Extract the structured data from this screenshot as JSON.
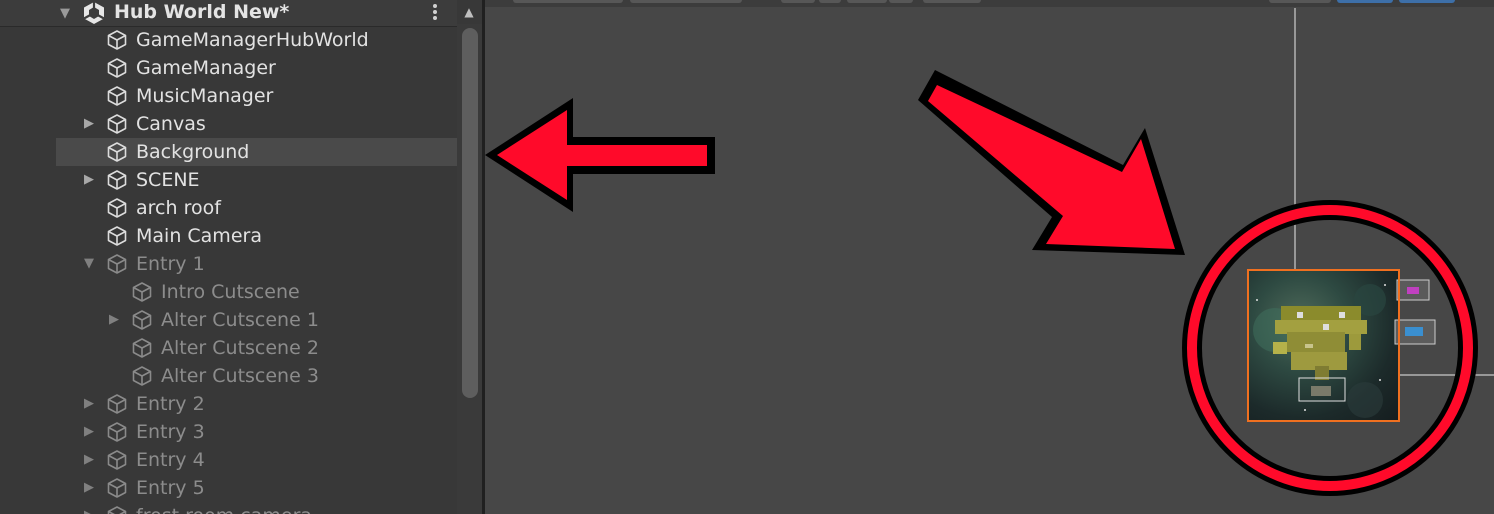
{
  "hierarchy": {
    "scene_title": "Hub World New*",
    "items": [
      {
        "label": "GameManagerHubWorld",
        "depth": 0,
        "expand": "none",
        "dim": false,
        "selected": false
      },
      {
        "label": "GameManager",
        "depth": 0,
        "expand": "none",
        "dim": false,
        "selected": false
      },
      {
        "label": "MusicManager",
        "depth": 0,
        "expand": "none",
        "dim": false,
        "selected": false
      },
      {
        "label": "Canvas",
        "depth": 0,
        "expand": "collapsed",
        "dim": false,
        "selected": false
      },
      {
        "label": "Background",
        "depth": 0,
        "expand": "none",
        "dim": false,
        "selected": true
      },
      {
        "label": "SCENE",
        "depth": 0,
        "expand": "collapsed",
        "dim": false,
        "selected": false
      },
      {
        "label": "arch roof",
        "depth": 0,
        "expand": "none",
        "dim": false,
        "selected": false
      },
      {
        "label": "Main Camera",
        "depth": 0,
        "expand": "none",
        "dim": false,
        "selected": false
      },
      {
        "label": "Entry 1",
        "depth": 0,
        "expand": "expanded",
        "dim": true,
        "selected": false
      },
      {
        "label": "Intro Cutscene",
        "depth": 1,
        "expand": "none",
        "dim": true,
        "selected": false
      },
      {
        "label": "Alter Cutscene 1",
        "depth": 1,
        "expand": "collapsed",
        "dim": true,
        "selected": false
      },
      {
        "label": "Alter Cutscene 2",
        "depth": 1,
        "expand": "none",
        "dim": true,
        "selected": false
      },
      {
        "label": "Alter Cutscene 3",
        "depth": 1,
        "expand": "none",
        "dim": true,
        "selected": false
      },
      {
        "label": "Entry 2",
        "depth": 0,
        "expand": "collapsed",
        "dim": true,
        "selected": false
      },
      {
        "label": "Entry 3",
        "depth": 0,
        "expand": "collapsed",
        "dim": true,
        "selected": false
      },
      {
        "label": "Entry 4",
        "depth": 0,
        "expand": "collapsed",
        "dim": true,
        "selected": false
      },
      {
        "label": "Entry 5",
        "depth": 0,
        "expand": "collapsed",
        "dim": true,
        "selected": false
      },
      {
        "label": "frost room camera",
        "depth": 0,
        "expand": "collapsed",
        "dim": true,
        "selected": false
      }
    ]
  },
  "scene": {
    "selection_color": "#f07020",
    "annotation_color": "#ff0a2a"
  },
  "icons": {
    "scene": "unity-logo-icon",
    "gameobject": "gameobject-cube-icon",
    "menu": "kebab-menu-icon",
    "fold": "triangle-icon"
  }
}
